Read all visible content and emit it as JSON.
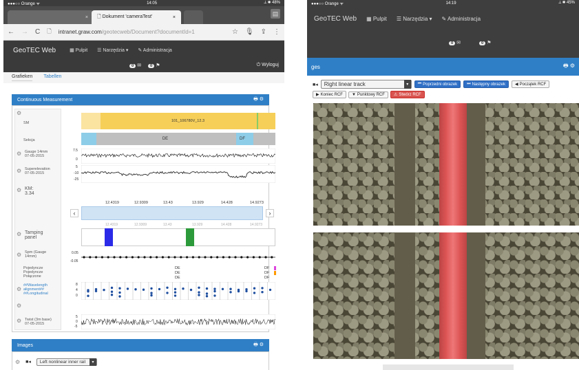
{
  "left": {
    "status": {
      "carrier": "●●●○○ Orange ᯤ",
      "time": "14:05",
      "battery": "⟂ ✱ 48%"
    },
    "browser_tabs": [
      {
        "label": "Dokument 'cameraTest'",
        "close": "×"
      }
    ],
    "omnibox": {
      "url_main": "intranet.graw.com",
      "url_rest": "/geotecweb/Document?documentId=1"
    },
    "app": {
      "brand": "GeoTEC Web",
      "nav": [
        "Pulpit",
        "Narzędzia ▾",
        "Administracja"
      ],
      "mail_count": "0",
      "flag_count": "0",
      "logout": "Wyloguj"
    },
    "subtabs": [
      "Grafieken",
      "Tabellen"
    ],
    "cm_panel": {
      "title": "Continuous Measurement",
      "rows": [
        {
          "label": "SM"
        },
        {
          "label": "Sekcja"
        },
        {
          "label": "Gauge 14mm\n07-05-2015"
        },
        {
          "label": "Superelevation\n07-05-2015"
        },
        {
          "label": "KM:\n3.34"
        },
        {
          "label": "Tamping\npanel"
        },
        {
          "label": "Spm (Gauge\n14mm)"
        },
        {
          "label": "Pojedyncze\nPojedyncze\nPołączone"
        },
        {
          "label": "##Wavelength\nalignment##\n##Longitudinal"
        },
        {
          "label": ""
        },
        {
          "label": "Twist (3m base)\n07-05-2015"
        }
      ],
      "sm_label": "101_106780V_12.3",
      "sekcja_de": "DE",
      "sekcja_df": "DF",
      "km_ticks": [
        "12.4319",
        "12.9309",
        "13.43",
        "13.929",
        "14.428",
        "14.9273"
      ],
      "gauge_ticks": [
        "7.5",
        "0"
      ],
      "super_ticks": [
        "5",
        "-10",
        "-25"
      ],
      "spm_ticks": [
        "0.05",
        "-0.05"
      ],
      "poj_de": [
        "DE",
        "DE",
        "DE"
      ],
      "poj_df": [
        "DF",
        "DF",
        "DF"
      ],
      "wave_ticks": [
        "8",
        "4",
        "0"
      ],
      "twist_ticks": [
        "5",
        "0",
        "-5"
      ]
    },
    "images_panel": {
      "title": "Images",
      "select": "Left nonlinear inner rail"
    }
  },
  "right": {
    "status": {
      "carrier": "●●●○○ Orange ᯤ",
      "time": "14:19",
      "battery": "⟂ ✱ 45%"
    },
    "app": {
      "brand": "GeoTEC Web",
      "nav": [
        "Pulpit",
        "Narzędzia ▾",
        "Administracja"
      ],
      "mail_count": "0",
      "flag_count": "0"
    },
    "images_title": "ges",
    "select": "Right linear track",
    "buttons": {
      "prev": "Poprzedni obrazek",
      "next": "Następny obrazek",
      "start": "Początek RCF",
      "end": "Koniec RCF",
      "punktowy": "Punktowy RCF",
      "create": "Stwórz RCF"
    }
  }
}
